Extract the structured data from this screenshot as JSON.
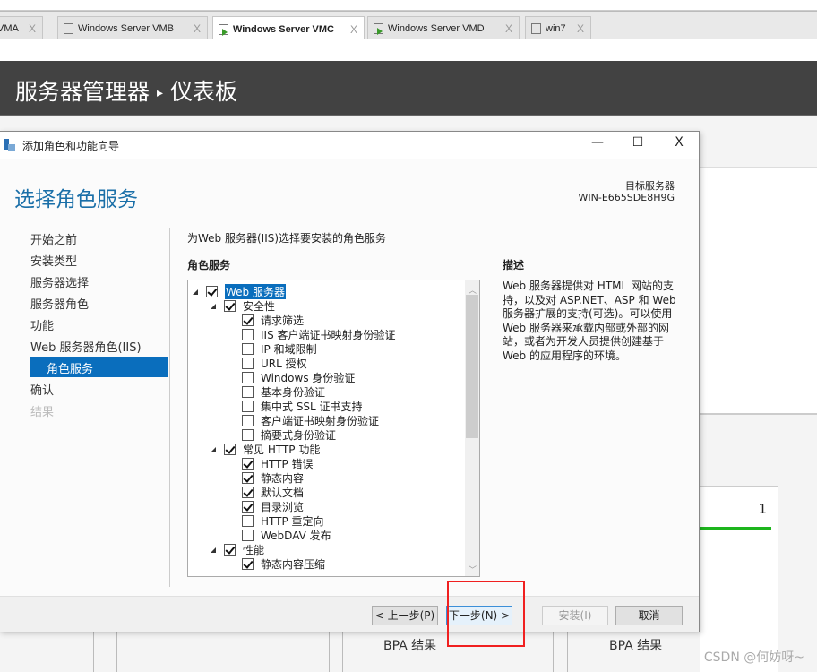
{
  "browser_tabs": [
    {
      "label": "VMA",
      "active": false,
      "running": false
    },
    {
      "label": "Windows Server VMB",
      "active": false,
      "running": false
    },
    {
      "label": "Windows Server VMC",
      "active": true,
      "running": true
    },
    {
      "label": "Windows Server VMD",
      "active": false,
      "running": true
    },
    {
      "label": "win7",
      "active": false,
      "running": false
    }
  ],
  "tab_close": "X",
  "server_manager": {
    "title": "服务器管理器",
    "separator": "▸",
    "page": "仪表板",
    "card_count": "1",
    "bpa_left": "BPA 结果",
    "bpa_right": "BPA 结果"
  },
  "dialog": {
    "title": "添加角色和功能向导",
    "minimize": "—",
    "maximize": "☐",
    "close": "X",
    "page_title": "选择角色服务",
    "target_label": "目标服务器",
    "target_server": "WIN-E665SDE8H9G",
    "nav": [
      {
        "label": "开始之前",
        "state": "normal"
      },
      {
        "label": "安装类型",
        "state": "normal"
      },
      {
        "label": "服务器选择",
        "state": "normal"
      },
      {
        "label": "服务器角色",
        "state": "normal"
      },
      {
        "label": "功能",
        "state": "normal"
      },
      {
        "label": "Web 服务器角色(IIS)",
        "state": "normal"
      },
      {
        "label": "角色服务",
        "state": "selected"
      },
      {
        "label": "确认",
        "state": "normal"
      },
      {
        "label": "结果",
        "state": "disabled"
      }
    ],
    "subtitle": "为Web 服务器(IIS)选择要安装的角色服务",
    "role_services_header": "角色服务",
    "tree": [
      {
        "label": "Web 服务器",
        "level": 0,
        "checked": true,
        "expander": true,
        "highlight": true
      },
      {
        "label": "安全性",
        "level": 1,
        "checked": true,
        "expander": true
      },
      {
        "label": "请求筛选",
        "level": 2,
        "checked": true
      },
      {
        "label": "IIS 客户端证书映射身份验证",
        "level": 2,
        "checked": false
      },
      {
        "label": "IP 和域限制",
        "level": 2,
        "checked": false
      },
      {
        "label": "URL 授权",
        "level": 2,
        "checked": false
      },
      {
        "label": "Windows 身份验证",
        "level": 2,
        "checked": false
      },
      {
        "label": "基本身份验证",
        "level": 2,
        "checked": false
      },
      {
        "label": "集中式 SSL 证书支持",
        "level": 2,
        "checked": false
      },
      {
        "label": "客户端证书映射身份验证",
        "level": 2,
        "checked": false
      },
      {
        "label": "摘要式身份验证",
        "level": 2,
        "checked": false
      },
      {
        "label": "常见 HTTP 功能",
        "level": 1,
        "checked": true,
        "expander": true
      },
      {
        "label": "HTTP 错误",
        "level": 2,
        "checked": true
      },
      {
        "label": "静态内容",
        "level": 2,
        "checked": true
      },
      {
        "label": "默认文档",
        "level": 2,
        "checked": true
      },
      {
        "label": "目录浏览",
        "level": 2,
        "checked": true
      },
      {
        "label": "HTTP 重定向",
        "level": 2,
        "checked": false
      },
      {
        "label": "WebDAV 发布",
        "level": 2,
        "checked": false
      },
      {
        "label": "性能",
        "level": 1,
        "checked": true,
        "expander": true
      },
      {
        "label": "静态内容压缩",
        "level": 2,
        "checked": true
      }
    ],
    "description_header": "描述",
    "description": "Web 服务器提供对 HTML 网站的支持，以及对 ASP.NET、ASP 和 Web 服务器扩展的支持(可选)。可以使用 Web 服务器来承载内部或外部的网站，或者为开发人员提供创建基于 Web 的应用程序的环境。",
    "buttons": {
      "prev": "< 上一步(P)",
      "next": "下一步(N) >",
      "install": "安装(I)",
      "cancel": "取消"
    }
  },
  "watermark": "CSDN @何妨呀~",
  "colors": {
    "accent": "#0a6ebd",
    "header": "#424242",
    "annotation": "#f02020",
    "status_green": "#1db51d"
  }
}
